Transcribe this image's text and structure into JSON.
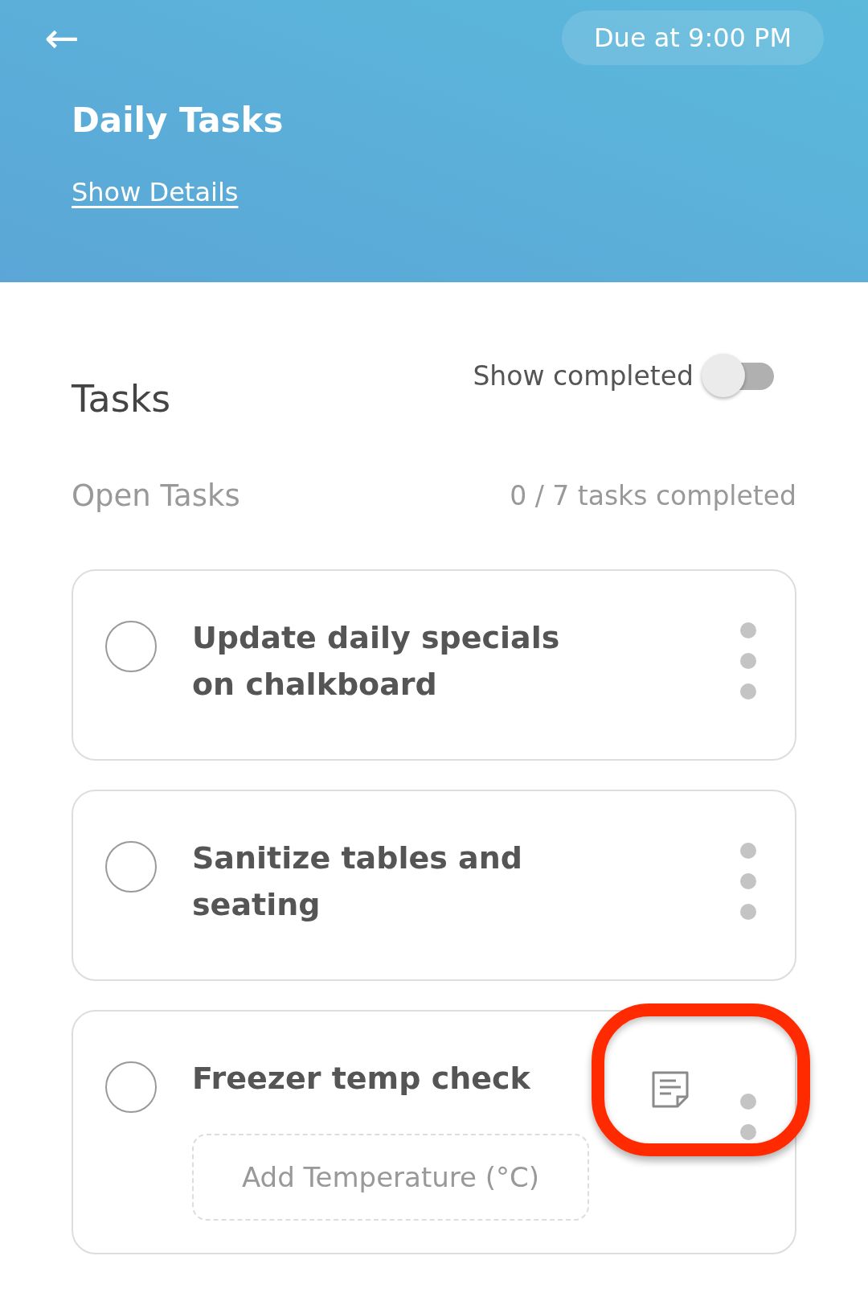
{
  "header": {
    "back": "←",
    "due": "Due at 9:00 PM",
    "title": "Daily Tasks",
    "link": "Show Details"
  },
  "tasks_section": {
    "title": "Tasks",
    "toggle_label": "Show completed",
    "toggle_on": false
  },
  "open_tasks": {
    "title": "Open Tasks",
    "progress": "0 / 7 tasks completed"
  },
  "tasks": [
    {
      "kind": "plain",
      "title": "Update daily specials on chalkboard",
      "checked": false
    },
    {
      "kind": "plain",
      "title": "Sanitize tables and seating",
      "checked": false
    },
    {
      "kind": "temperature",
      "title": "Freezer temp check",
      "checked": false,
      "placeholder": "Add Temperature (°C)",
      "highlighted": true
    }
  ]
}
